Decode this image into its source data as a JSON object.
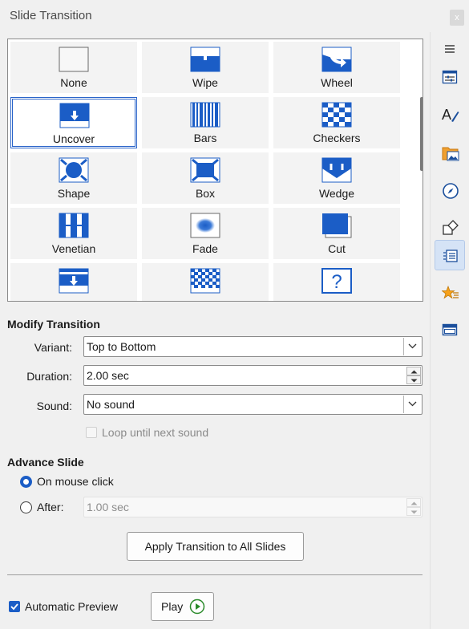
{
  "window": {
    "title": "Slide Transition",
    "close_label": "x"
  },
  "gallery": {
    "items": [
      {
        "label": "None",
        "icon": "none-transition-icon"
      },
      {
        "label": "Wipe",
        "icon": "wipe-transition-icon"
      },
      {
        "label": "Wheel",
        "icon": "wheel-transition-icon"
      },
      {
        "label": "Uncover",
        "icon": "uncover-transition-icon",
        "selected": true
      },
      {
        "label": "Bars",
        "icon": "bars-transition-icon"
      },
      {
        "label": "Checkers",
        "icon": "checkers-transition-icon"
      },
      {
        "label": "Shape",
        "icon": "shape-transition-icon"
      },
      {
        "label": "Box",
        "icon": "box-transition-icon"
      },
      {
        "label": "Wedge",
        "icon": "wedge-transition-icon"
      },
      {
        "label": "Venetian",
        "icon": "venetian-transition-icon"
      },
      {
        "label": "Fade",
        "icon": "fade-transition-icon"
      },
      {
        "label": "Cut",
        "icon": "cut-transition-icon"
      },
      {
        "label": "",
        "icon": "cover-transition-icon"
      },
      {
        "label": "",
        "icon": "dissolve-transition-icon"
      },
      {
        "label": "",
        "icon": "random-transition-icon"
      }
    ],
    "accent_color": "#1b5dc6"
  },
  "modify": {
    "title": "Modify Transition",
    "variant_label": "Variant:",
    "variant_value": "Top to Bottom",
    "duration_label": "Duration:",
    "duration_value": "2.00 sec",
    "sound_label": "Sound:",
    "sound_value": "No sound",
    "loop_label": "Loop until next sound",
    "loop_checked": false
  },
  "advance": {
    "title": "Advance Slide",
    "on_click_label": "On mouse click",
    "on_click_selected": true,
    "after_label": "After:",
    "after_value": "1.00 sec"
  },
  "apply_all_label": "Apply Transition to All Slides",
  "footer": {
    "auto_preview_label": "Automatic Preview",
    "auto_preview_checked": true,
    "play_label": "Play"
  },
  "sidebar": {
    "items": [
      {
        "icon": "menu-icon"
      },
      {
        "icon": "properties-icon"
      },
      {
        "icon": "styles-icon"
      },
      {
        "icon": "gallery-icon"
      },
      {
        "icon": "navigator-icon"
      },
      {
        "icon": "shapes-icon"
      },
      {
        "icon": "slide-transition-icon",
        "active": true
      },
      {
        "icon": "animation-icon"
      },
      {
        "icon": "master-slides-icon"
      }
    ]
  }
}
